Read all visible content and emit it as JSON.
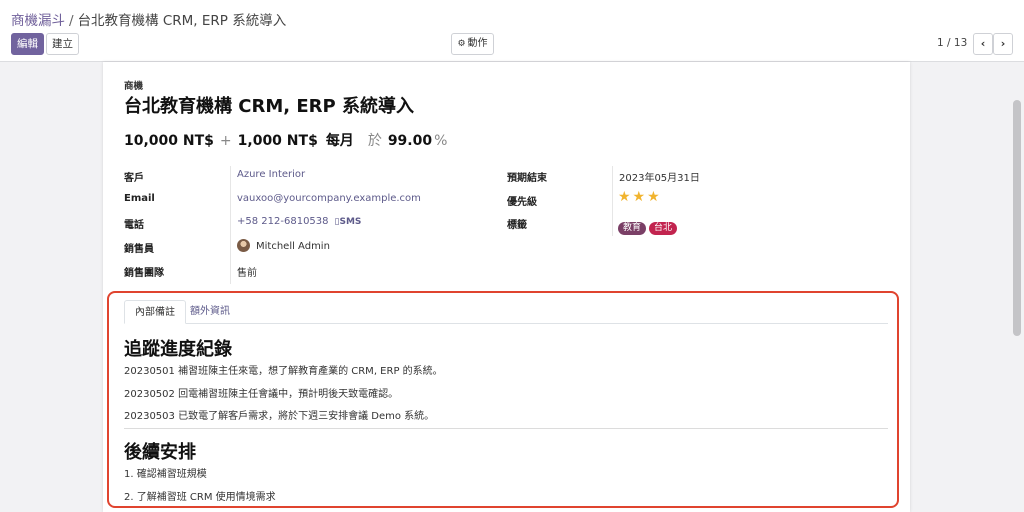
{
  "breadcrumb": {
    "parent": "商機漏斗",
    "separator": "/",
    "current": "台北教育機構 CRM, ERP 系統導入"
  },
  "toolbar": {
    "edit_label": "編輯",
    "create_label": "建立",
    "action_label": "動作",
    "action_icon": "gear-icon",
    "pager": "1 / 13",
    "prev_label": "‹",
    "next_label": "›"
  },
  "record": {
    "type_label": "商機",
    "title": "台北教育機構 CRM, ERP 系統導入",
    "expected_revenue": "10,000 NT$",
    "plus": "+",
    "recurring_revenue": "1,000 NT$",
    "recurring_period": "每月",
    "at_label": "於",
    "probability": "99.00",
    "percent": "%"
  },
  "fields_left": {
    "customer_label": "客戶",
    "customer_value": "Azure Interior",
    "email_label": "Email",
    "email_value": "vauxoo@yourcompany.example.com",
    "phone_label": "電話",
    "phone_value": "+58 212-6810538",
    "sms_label": "▯SMS",
    "salesperson_label": "銷售員",
    "salesperson_value": "Mitchell Admin",
    "team_label": "銷售團隊",
    "team_value": "售前"
  },
  "fields_right": {
    "deadline_label": "預期結束",
    "deadline_value": "2023年05月31日",
    "priority_label": "優先級",
    "priority_stars": "★★★",
    "priority_level": 3,
    "priority_max": 3,
    "tags_label": "標籤",
    "tags": [
      {
        "label": "教育",
        "color": "#7a3f66"
      },
      {
        "label": "台北",
        "color": "#c2244f"
      }
    ]
  },
  "tabs": {
    "internal_notes": "內部備註",
    "extra_info": "額外資訊"
  },
  "notes": {
    "heading1": "追蹤進度紀錄",
    "lines1": [
      "20230501 補習班陳主任來電，想了解教育產業的 CRM, ERP 的系統。",
      "20230502 回電補習班陳主任會議中，預計明後天致電確認。",
      "20230503 已致電了解客戶需求，將於下週三安排會議 Demo 系統。"
    ],
    "heading2": "後續安排",
    "lines2": [
      "1. 確認補習班規模",
      "2. 了解補習班 CRM 使用情境需求"
    ]
  },
  "colors": {
    "primary": "#71639e",
    "link": "#5d5a8a",
    "star": "#f1b42f",
    "highlight_border": "#e0442f"
  }
}
